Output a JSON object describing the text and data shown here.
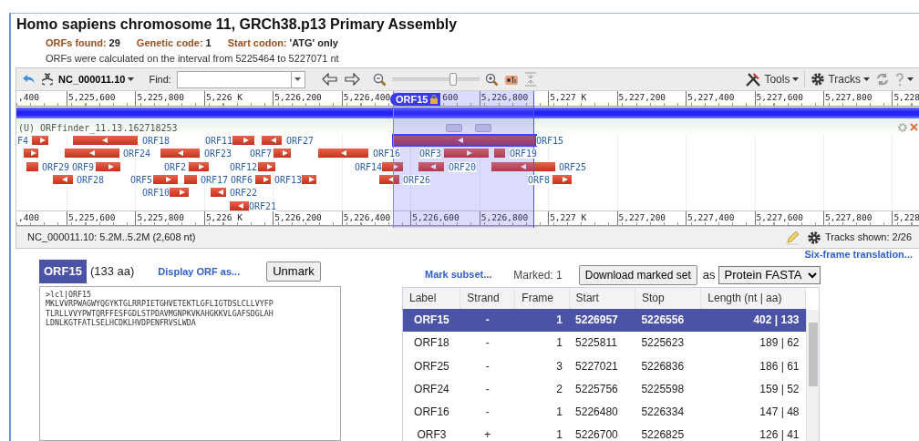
{
  "title": "Homo sapiens chromosome 11, GRCh38.p13 Primary Assembly",
  "summary": [
    {
      "label": "ORFs found:",
      "value": "29"
    },
    {
      "label": "Genetic code:",
      "value": "1"
    },
    {
      "label": "Start codon:",
      "value": "'ATG' only"
    }
  ],
  "interval_note": "ORFs were calculated on the interval from 5225464 to 5227071 nt",
  "viewer": {
    "toolbar": {
      "sequence": "NC_000011.10",
      "find_label": "Find:",
      "zoom": {
        "level": 0.7
      },
      "tools": "Tools",
      "tracks": "Tracks"
    },
    "top_ruler": [
      ",400",
      "5,225,600",
      "5,225,800",
      "5,226 K",
      "5,226,200",
      "5,226,400",
      "600",
      "5,226,800",
      "5,227 K",
      "5,227,200",
      "5,227,400",
      "5,227,600",
      "5,227,800",
      "5,228"
    ],
    "selection_flag": "ORF15",
    "track_title": "(U) ORFfinder_11.13.162718253",
    "features": [
      {
        "label": "F4",
        "kind": "forward",
        "selected": false
      },
      {
        "label": "ORF18",
        "kind": "reverse",
        "selected": false
      },
      {
        "label": "ORF11",
        "kind": "forward",
        "selected": false
      },
      {
        "label": "ORF27",
        "kind": "reverse",
        "selected": false
      },
      {
        "label": "ORF15",
        "kind": "reverse",
        "selected": true
      },
      {
        "kind": "forward",
        "selected": false
      },
      {
        "label": "ORF24",
        "kind": "reverse",
        "selected": false
      },
      {
        "label": "ORF23",
        "kind": "reverse",
        "selected": false
      },
      {
        "label": "ORF7",
        "kind": "forward",
        "selected": false
      },
      {
        "label": "ORF16",
        "kind": "reverse",
        "selected": false
      },
      {
        "label": "ORF3",
        "kind": "forward",
        "selected": false
      },
      {
        "label": "ORF19",
        "kind": "plain",
        "selected": false
      },
      {
        "label": "ORF29",
        "kind": "plain",
        "selected": false
      },
      {
        "label": "ORF9",
        "kind": "forward",
        "selected": false
      },
      {
        "label": "ORF2",
        "kind": "forward",
        "selected": false
      },
      {
        "label": "ORF12",
        "kind": "forward",
        "selected": false
      },
      {
        "label": "ORF14",
        "kind": "forward",
        "selected": false
      },
      {
        "label": "ORF20",
        "kind": "reverse",
        "selected": false
      },
      {
        "label": "ORF25",
        "kind": "reverse",
        "selected": false
      },
      {
        "label": "ORF28",
        "kind": "reverse",
        "selected": false
      },
      {
        "label": "ORF5",
        "kind": "forward",
        "selected": false
      },
      {
        "label": "ORF17",
        "kind": "plain",
        "selected": false
      },
      {
        "label": "ORF6",
        "kind": "forward",
        "selected": false
      },
      {
        "label": "ORF13",
        "kind": "forward",
        "selected": false
      },
      {
        "label": "ORF26",
        "kind": "reverse",
        "selected": false
      },
      {
        "label": "ORF8",
        "kind": "forward",
        "selected": false
      },
      {
        "label": "ORF10",
        "kind": "forward",
        "selected": false
      },
      {
        "label": "ORF22",
        "kind": "reverse",
        "selected": false
      },
      {
        "label": "ORF21",
        "kind": "reverse",
        "selected": false
      }
    ],
    "bottom_ruler": [
      ",400",
      "5,225,600",
      "5,225,800",
      "5,226 K",
      "5,226,200",
      "5,226,400",
      "5,226,600",
      "5,226,800",
      "5,227 K",
      "5,227,200",
      "5,227,400",
      "5,227,600",
      "5,227,800",
      "5,228"
    ],
    "status": "NC_000011.10: 5.2M..5.2M (2,608 nt)",
    "tracks_shown": "Tracks shown: 2/26"
  },
  "six_frame_link": "Six-frame translation...",
  "orf_panel": {
    "name": "ORF15",
    "length": "(133 aa)",
    "display_link": "Display ORF as...",
    "unmark_button": "Unmark",
    "sequence": ">lcl|ORF15\nMKLVVRPWAGWYQGYKTGLRRPIETGHVETEKTLGFLIGTDSLCLLVYFP\nTLRLLVVYPWTQRFFESFGDLSTPDAVMGNPKVKAHGKKVLGAFSDGLAH\nLDNLKGTFATLSELHCDKLHVDPENFRVSLWDA"
  },
  "marking": {
    "mark_subset": "Mark subset...",
    "marked": "Marked: 1",
    "download_button": "Download marked set",
    "as_label": "as",
    "format": "Protein FASTA"
  },
  "table": {
    "columns": [
      "Label",
      "Strand",
      "Frame",
      "Start",
      "Stop",
      "Length (nt | aa)"
    ],
    "rows": [
      {
        "cells": [
          "ORF15",
          "-",
          "1",
          "5226957",
          "5226556",
          "402 | 133"
        ],
        "selected": true
      },
      {
        "cells": [
          "ORF18",
          "-",
          "1",
          "5225811",
          "5225623",
          "189 | 62"
        ],
        "selected": false
      },
      {
        "cells": [
          "ORF25",
          "-",
          "3",
          "5227021",
          "5226836",
          "186 | 61"
        ],
        "selected": false
      },
      {
        "cells": [
          "ORF24",
          "-",
          "2",
          "5225756",
          "5225598",
          "159 | 52"
        ],
        "selected": false
      },
      {
        "cells": [
          "ORF16",
          "-",
          "1",
          "5226480",
          "5226334",
          "147 | 48"
        ],
        "selected": false
      },
      {
        "cells": [
          "ORF3",
          "+",
          "1",
          "5226700",
          "5226825",
          "126 | 41"
        ],
        "selected": false
      }
    ]
  }
}
